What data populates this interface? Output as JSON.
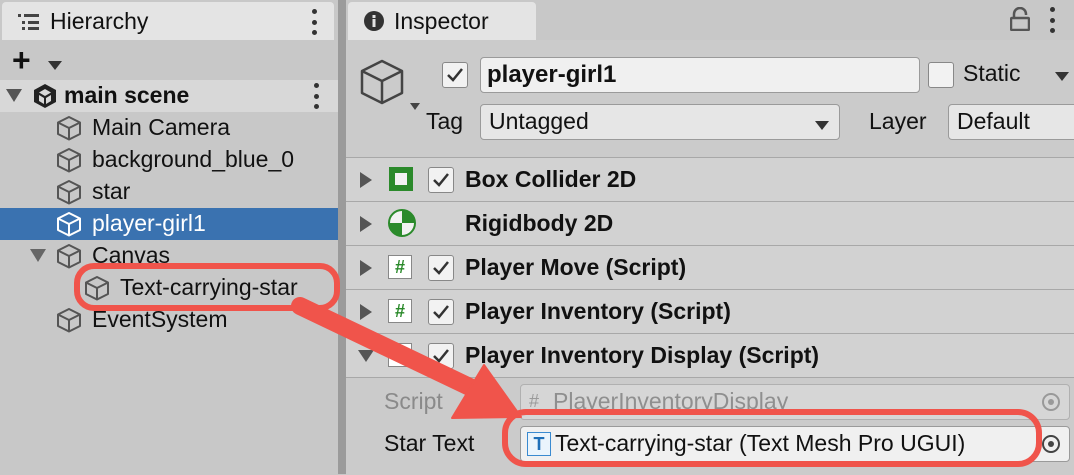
{
  "hierarchy": {
    "tab_label": "Hierarchy",
    "add_symbol": "+",
    "scene_name": "main scene",
    "items": [
      {
        "label": "Main Camera"
      },
      {
        "label": "background_blue_0"
      },
      {
        "label": "star"
      },
      {
        "label": "player-girl1",
        "selected": true
      },
      {
        "label": "Canvas",
        "expanded": true
      },
      {
        "label": "Text-carrying-star",
        "highlighted": true
      },
      {
        "label": "EventSystem"
      }
    ]
  },
  "inspector": {
    "tab_label": "Inspector",
    "object_name": "player-girl1",
    "active_checked": true,
    "static_label": "Static",
    "static_checked": false,
    "tag_label": "Tag",
    "tag_value": "Untagged",
    "layer_label": "Layer",
    "layer_value": "Default",
    "components": [
      {
        "name": "Box Collider 2D",
        "icon": "box-collider-icon",
        "checked": true
      },
      {
        "name": "Rigidbody 2D",
        "icon": "rigidbody-icon",
        "checked": null
      },
      {
        "name": "Player Move (Script)",
        "icon": "script-icon",
        "checked": true
      },
      {
        "name": "Player Inventory (Script)",
        "icon": "script-icon",
        "checked": true
      },
      {
        "name": "Player Inventory Display (Script)",
        "icon": "script-icon",
        "checked": true
      }
    ],
    "script_field_label": "Script",
    "script_field_value": "PlayerInventoryDisplay",
    "star_text_label": "Star Text",
    "star_text_value": "Text-carrying-star (Text Mesh Pro UGUI)"
  },
  "colors": {
    "selection": "#3a72b0",
    "annotation": "#f0544b",
    "icon_green": "#2a8a2a"
  }
}
